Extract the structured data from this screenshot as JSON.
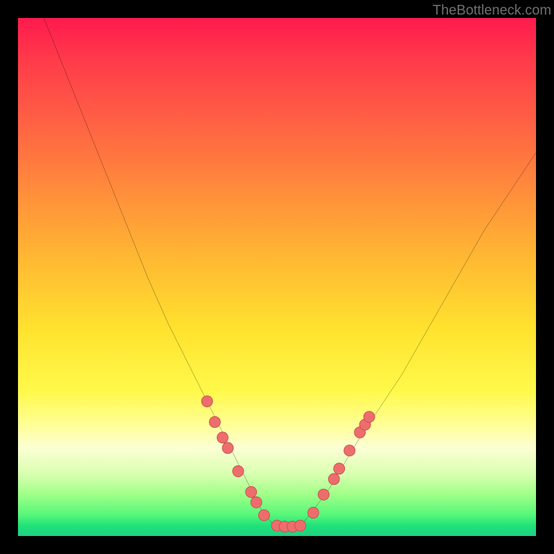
{
  "watermark": "TheBottleneck.com",
  "chart_data": {
    "type": "line",
    "title": "",
    "xlabel": "",
    "ylabel": "",
    "xlim": [
      0,
      100
    ],
    "ylim": [
      0,
      100
    ],
    "curve": {
      "name": "bottleneck-curve",
      "x": [
        5,
        9,
        13,
        17,
        21,
        25,
        29,
        33,
        36,
        39,
        41,
        43,
        45,
        47,
        49,
        51,
        53,
        55,
        57,
        60,
        63,
        66,
        70,
        74,
        78,
        82,
        86,
        90,
        94,
        98,
        100
      ],
      "y": [
        100,
        90,
        80,
        70,
        60,
        50,
        41,
        33,
        27,
        21,
        17,
        13,
        9,
        5,
        2.5,
        1.8,
        1.8,
        2.5,
        5,
        9,
        14,
        19,
        25,
        31,
        38,
        45,
        52,
        59,
        65,
        71,
        74
      ]
    },
    "markers": [
      {
        "x": 36.5,
        "y": 26
      },
      {
        "x": 38,
        "y": 22
      },
      {
        "x": 39.5,
        "y": 19
      },
      {
        "x": 40.5,
        "y": 17
      },
      {
        "x": 42.5,
        "y": 12.5
      },
      {
        "x": 45,
        "y": 8.5
      },
      {
        "x": 46,
        "y": 6.5
      },
      {
        "x": 47.5,
        "y": 4
      },
      {
        "x": 50,
        "y": 2
      },
      {
        "x": 51.5,
        "y": 1.8
      },
      {
        "x": 53,
        "y": 1.8
      },
      {
        "x": 54.5,
        "y": 2
      },
      {
        "x": 57,
        "y": 4.5
      },
      {
        "x": 59,
        "y": 8
      },
      {
        "x": 61,
        "y": 11
      },
      {
        "x": 62,
        "y": 13
      },
      {
        "x": 64,
        "y": 16.5
      },
      {
        "x": 66,
        "y": 20
      },
      {
        "x": 67,
        "y": 21.5
      },
      {
        "x": 67.8,
        "y": 23
      }
    ],
    "marker_style": {
      "fill": "#ed6d6d",
      "stroke": "#c74b4b",
      "r": 8
    },
    "background_gradient": [
      "#ff1a4d",
      "#ffe22e",
      "#1ed183"
    ]
  }
}
